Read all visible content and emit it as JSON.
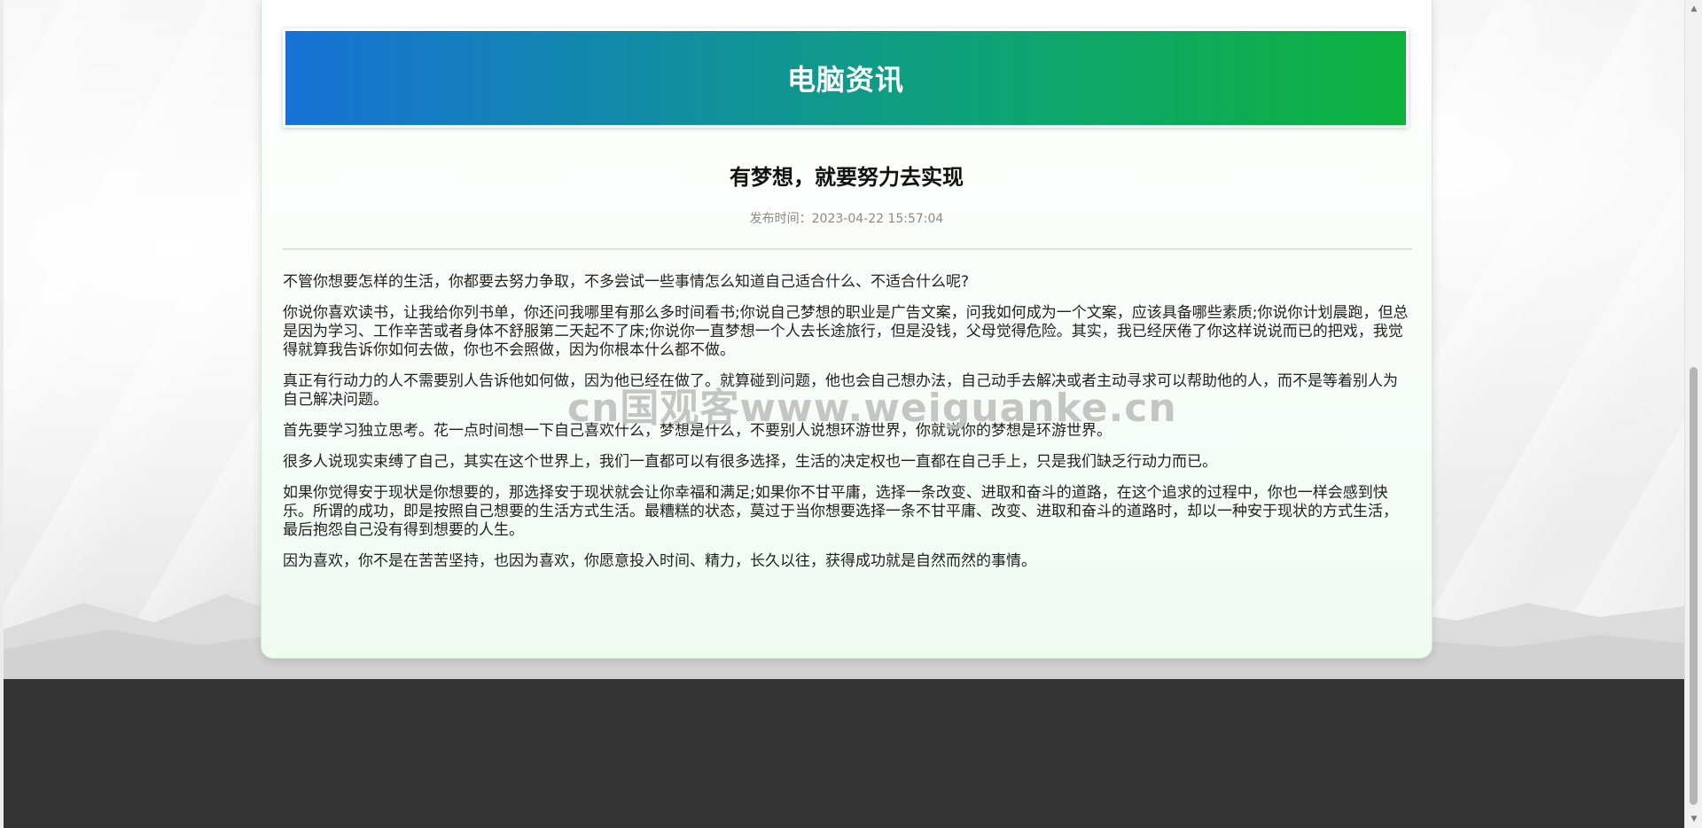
{
  "banner": {
    "title": "电脑资讯"
  },
  "article": {
    "title": "有梦想，就要努力去实现",
    "publish_label": "发布时间：",
    "publish_time": "2023-04-22 15:57:04",
    "paragraphs": [
      "不管你想要怎样的生活，你都要去努力争取，不多尝试一些事情怎么知道自己适合什么、不适合什么呢?",
      "你说你喜欢读书，让我给你列书单，你还问我哪里有那么多时间看书;你说自己梦想的职业是广告文案，问我如何成为一个文案，应该具备哪些素质;你说你计划晨跑，但总是因为学习、工作辛苦或者身体不舒服第二天起不了床;你说你一直梦想一个人去长途旅行，但是没钱，父母觉得危险。其实，我已经厌倦了你这样说说而已的把戏，我觉得就算我告诉你如何去做，你也不会照做，因为你根本什么都不做。",
      "真正有行动力的人不需要别人告诉他如何做，因为他已经在做了。就算碰到问题，他也会自己想办法，自己动手去解决或者主动寻求可以帮助他的人，而不是等着别人为自己解决问题。",
      "首先要学习独立思考。花一点时间想一下自己喜欢什么，梦想是什么，不要别人说想环游世界，你就说你的梦想是环游世界。",
      "很多人说现实束缚了自己，其实在这个世界上，我们一直都可以有很多选择，生活的决定权也一直都在自己手上，只是我们缺乏行动力而已。",
      "如果你觉得安于现状是你想要的，那选择安于现状就会让你幸福和满足;如果你不甘平庸，选择一条改变、进取和奋斗的道路，在这个追求的过程中，你也一样会感到快乐。所谓的成功，即是按照自己想要的生活方式生活。最糟糕的状态，莫过于当你想要选择一条不甘平庸、改变、进取和奋斗的道路时，却以一种安于现状的方式生活，最后抱怨自己没有得到想要的人生。",
      "因为喜欢，你不是在苦苦坚持，也因为喜欢，你愿意投入时间、精力，长久以往，获得成功就是自然而然的事情。"
    ]
  },
  "watermark": {
    "text": "cn国观客www.weiguanke.cn"
  },
  "colors": {
    "banner_start": "#1672d6",
    "banner_end": "#0db23d",
    "footer": "#333333"
  }
}
